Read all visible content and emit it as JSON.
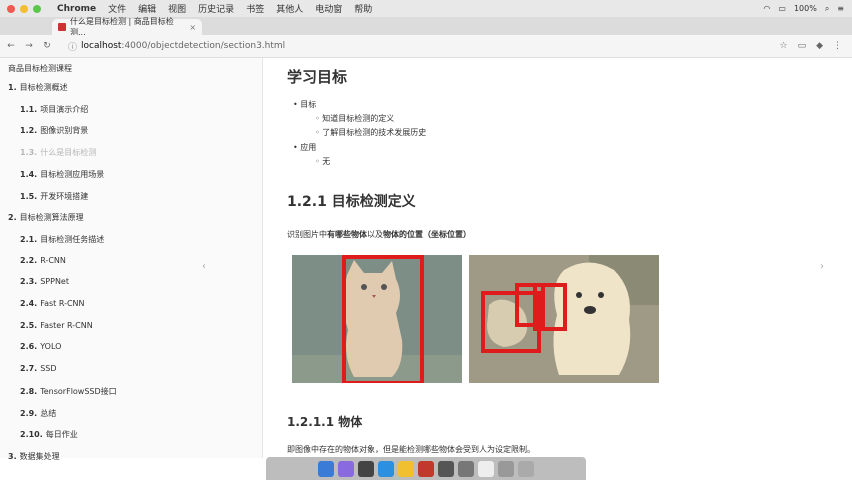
{
  "menubar": {
    "app": "Chrome",
    "menus": [
      "文件",
      "编辑",
      "视图",
      "历史记录",
      "书签",
      "其他人",
      "电动窗",
      "帮助"
    ],
    "battery": "100%"
  },
  "tab": {
    "title": "什么是目标检测 | 商品目标检测..."
  },
  "address": {
    "host": "localhost",
    "path": ":4000/objectdetection/section3.html"
  },
  "sidebar": {
    "title": "商品目标检测课程",
    "items": [
      {
        "num": "1.",
        "label": "目标检测概述",
        "level": 1
      },
      {
        "num": "1.1.",
        "label": "项目演示介绍",
        "level": 2
      },
      {
        "num": "1.2.",
        "label": "图像识别背景",
        "level": 2
      },
      {
        "num": "1.3.",
        "label": "什么是目标检测",
        "level": 2,
        "active": true
      },
      {
        "num": "1.4.",
        "label": "目标检测应用场景",
        "level": 2
      },
      {
        "num": "1.5.",
        "label": "开发环境搭建",
        "level": 2
      },
      {
        "num": "2.",
        "label": "目标检测算法原理",
        "level": 1
      },
      {
        "num": "2.1.",
        "label": "目标检测任务描述",
        "level": 2
      },
      {
        "num": "2.2.",
        "label": "R-CNN",
        "level": 2
      },
      {
        "num": "2.3.",
        "label": "SPPNet",
        "level": 2
      },
      {
        "num": "2.4.",
        "label": "Fast R-CNN",
        "level": 2
      },
      {
        "num": "2.5.",
        "label": "Faster R-CNN",
        "level": 2
      },
      {
        "num": "2.6.",
        "label": "YOLO",
        "level": 2
      },
      {
        "num": "2.7.",
        "label": "SSD",
        "level": 2
      },
      {
        "num": "2.8.",
        "label": "TensorFlowSSD接口",
        "level": 2
      },
      {
        "num": "2.9.",
        "label": "总结",
        "level": 2
      },
      {
        "num": "2.10.",
        "label": "每日作业",
        "level": 2
      },
      {
        "num": "3.",
        "label": "数据集处理",
        "level": 1
      }
    ]
  },
  "content": {
    "heading": "学习目标",
    "bullets": {
      "goal": "目标",
      "goal_items": [
        "知道目标检测的定义",
        "了解目标检测的技术发展历史"
      ],
      "apply": "应用",
      "apply_items": [
        "无"
      ]
    },
    "section_title": "1.2.1 目标检测定义",
    "definition_prefix": "识别图片中",
    "definition_bold1": "有哪些物体",
    "definition_mid": "以及",
    "definition_bold2": "物体的位置（坐标位置）",
    "subsection_title": "1.2.1.1 物体",
    "subsection_text": "即图像中存在的物体对象，但是能检测哪些物体会受到人为设定限制。"
  },
  "colors": {
    "box": "#e01b1b",
    "sidebar_active": "#b7b7b7"
  }
}
